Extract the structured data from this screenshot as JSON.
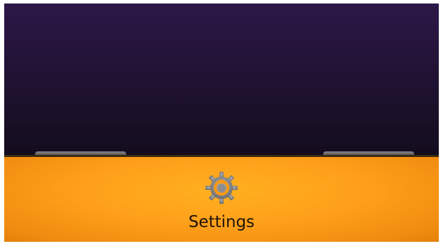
{
  "options_menu": {
    "items": [
      {
        "label": "Settings",
        "icon": "settings-gear-icon"
      }
    ]
  },
  "colors": {
    "wallpaper_top": "#2c1848",
    "wallpaper_bottom": "#130c1d",
    "menu_background": "#ffa01a",
    "menu_label": "#1e1408",
    "icon_gray": "#8c8c8c",
    "icon_accent": "#ff9a10"
  }
}
